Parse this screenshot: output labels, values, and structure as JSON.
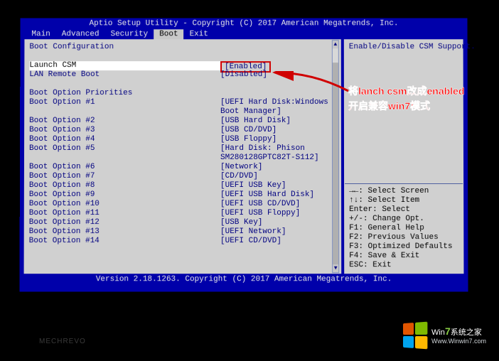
{
  "title_bar": "Aptio Setup Utility - Copyright (C) 2017 American Megatrends, Inc.",
  "menu": {
    "items": [
      "Main",
      "Advanced",
      "Security",
      "Boot",
      "Exit"
    ],
    "active_index": 3
  },
  "left": {
    "section_title": "Boot Configuration",
    "launch_csm_label": "Launch CSM",
    "launch_csm_value": "[Enabled]",
    "lan_remote_label": "LAN Remote Boot",
    "lan_remote_value": "[Disabled]",
    "priorities_title": "Boot Option Priorities",
    "options": [
      {
        "label": "Boot Option #1",
        "value": "[UEFI Hard Disk:Windows Boot Manager]"
      },
      {
        "label": "Boot Option #2",
        "value": "[USB Hard Disk]"
      },
      {
        "label": "Boot Option #3",
        "value": "[USB CD/DVD]"
      },
      {
        "label": "Boot Option #4",
        "value": "[USB Floppy]"
      },
      {
        "label": "Boot Option #5",
        "value": "[Hard Disk: Phison SM280128GPTC82T-S112]"
      },
      {
        "label": "Boot Option #6",
        "value": "[Network]"
      },
      {
        "label": "Boot Option #7",
        "value": "[CD/DVD]"
      },
      {
        "label": "Boot Option #8",
        "value": "[UEFI USB Key]"
      },
      {
        "label": "Boot Option #9",
        "value": "[UEFI USB Hard Disk]"
      },
      {
        "label": "Boot Option #10",
        "value": "[UEFI USB CD/DVD]"
      },
      {
        "label": "Boot Option #11",
        "value": "[UEFI USB Floppy]"
      },
      {
        "label": "Boot Option #12",
        "value": "[USB Key]"
      },
      {
        "label": "Boot Option #13",
        "value": "[UEFI Network]"
      },
      {
        "label": "Boot Option #14",
        "value": "[UEFI CD/DVD]"
      }
    ]
  },
  "right": {
    "description": "Enable/Disable CSM Support.",
    "help": [
      "→←: Select Screen",
      "↑↓: Select Item",
      "Enter: Select",
      "+/-: Change Opt.",
      "F1: General Help",
      "F2: Previous Values",
      "F3: Optimized Defaults",
      "F4: Save & Exit",
      "ESC: Exit"
    ]
  },
  "footer": "Version 2.18.1263. Copyright (C) 2017 American Megatrends, Inc.",
  "annotation": {
    "line1": "将lanch csm改成enabled",
    "line2": "开启兼容win7模式"
  },
  "laptop_brand": "MECHREVO",
  "watermark": {
    "line1_prefix": "Win",
    "line1_num": "7",
    "line1_suffix": "系统之家",
    "line2": "Www.Winwin7.com"
  }
}
